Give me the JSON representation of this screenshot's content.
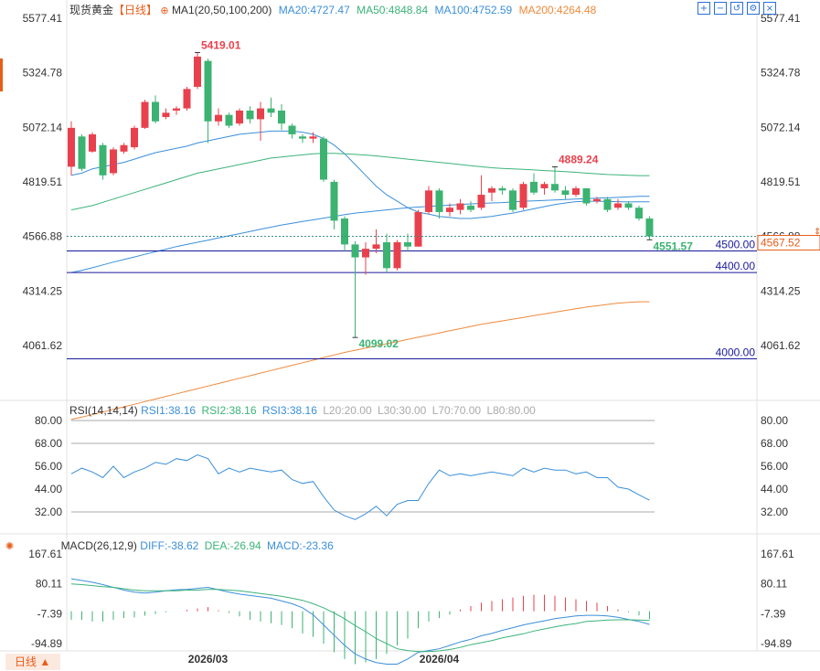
{
  "header": {
    "instrument": "现货黄金",
    "period": "【日线】",
    "ma_label": "MA1(20,50,100,200)",
    "ma20": "MA20:4727.47",
    "ma50": "MA50:4848.84",
    "ma100": "MA100:4752.59",
    "ma200": "MA200:4264.48"
  },
  "rsi_header": {
    "label": "RSI(14,14,14)",
    "rsi1": "RSI1:38.16",
    "rsi2": "RSI2:38.16",
    "rsi3": "RSI3:38.16",
    "l20": "L20:20.00",
    "l30": "L30:30.00",
    "l70": "L70:70.00",
    "l80": "L80:80.00"
  },
  "macd_header": {
    "label": "MACD(26,12,9)",
    "diff": "DIFF:-38.62",
    "dea": "DEA:-26.94",
    "macd": "MACD:-23.36"
  },
  "footer": {
    "period_button": "日线 ▲"
  },
  "colors": {
    "up": "#e8414d",
    "down": "#3cb371",
    "ma20": "#3b8fd9",
    "ma50": "#3cb37a",
    "ma100": "#3b8fd9",
    "ma200": "#f08a3c",
    "level": "#1a1a9c",
    "grid": "#e6e6e6",
    "accent": "#e85d1a"
  },
  "icons": [
    "add-circle-icon",
    "zoom-in-icon",
    "zoom-out-icon",
    "reset-icon",
    "settings-icon",
    "close-icon",
    "macd-settings-icon"
  ],
  "chart_data": [
    {
      "type": "candlestick",
      "title": "现货黄金",
      "y_ticks": [
        "5577.41",
        "5324.78",
        "5072.14",
        "4819.51",
        "4566.88",
        "4314.25",
        "4061.62"
      ],
      "ylim": [
        4061.62,
        5577.41
      ],
      "x_ticks": [
        {
          "index": 13,
          "label": "2026/03"
        },
        {
          "index": 35,
          "label": "2026/04"
        }
      ],
      "candles": [
        {
          "o": 4890,
          "h": 5100,
          "l": 4850,
          "c": 5070
        },
        {
          "o": 5030,
          "h": 5040,
          "l": 4870,
          "c": 4880
        },
        {
          "o": 4960,
          "h": 5050,
          "l": 4955,
          "c": 5040
        },
        {
          "o": 4990,
          "h": 5000,
          "l": 4830,
          "c": 4850
        },
        {
          "o": 4860,
          "h": 4980,
          "l": 4850,
          "c": 4970
        },
        {
          "o": 4960,
          "h": 5000,
          "l": 4950,
          "c": 4990
        },
        {
          "o": 4980,
          "h": 5080,
          "l": 4970,
          "c": 5070
        },
        {
          "o": 5070,
          "h": 5200,
          "l": 5065,
          "c": 5190
        },
        {
          "o": 5190,
          "h": 5220,
          "l": 5090,
          "c": 5100
        },
        {
          "o": 5120,
          "h": 5160,
          "l": 5110,
          "c": 5140
        },
        {
          "o": 5150,
          "h": 5170,
          "l": 5130,
          "c": 5160
        },
        {
          "o": 5160,
          "h": 5260,
          "l": 5150,
          "c": 5250
        },
        {
          "o": 5260,
          "h": 5419.01,
          "l": 5250,
          "c": 5400
        },
        {
          "o": 5380,
          "h": 5390,
          "l": 5000,
          "c": 5100
        },
        {
          "o": 5100,
          "h": 5160,
          "l": 5080,
          "c": 5130
        },
        {
          "o": 5130,
          "h": 5140,
          "l": 5070,
          "c": 5080
        },
        {
          "o": 5090,
          "h": 5160,
          "l": 5080,
          "c": 5150
        },
        {
          "o": 5150,
          "h": 5170,
          "l": 5090,
          "c": 5110
        },
        {
          "o": 5110,
          "h": 5190,
          "l": 5010,
          "c": 5160
        },
        {
          "o": 5160,
          "h": 5210,
          "l": 5120,
          "c": 5140
        },
        {
          "o": 5150,
          "h": 5180,
          "l": 5060,
          "c": 5090
        },
        {
          "o": 5080,
          "h": 5090,
          "l": 5020,
          "c": 5040
        },
        {
          "o": 5030,
          "h": 5040,
          "l": 5000,
          "c": 5020
        },
        {
          "o": 5020,
          "h": 5050,
          "l": 5000,
          "c": 5030
        },
        {
          "o": 5020,
          "h": 5030,
          "l": 4820,
          "c": 4830
        },
        {
          "o": 4820,
          "h": 4830,
          "l": 4600,
          "c": 4640
        },
        {
          "o": 4650,
          "h": 4660,
          "l": 4500,
          "c": 4530
        },
        {
          "o": 4530,
          "h": 4545,
          "l": 4099.02,
          "c": 4470
        },
        {
          "o": 4470,
          "h": 4540,
          "l": 4390,
          "c": 4510
        },
        {
          "o": 4510,
          "h": 4600,
          "l": 4490,
          "c": 4530
        },
        {
          "o": 4540,
          "h": 4580,
          "l": 4400,
          "c": 4420
        },
        {
          "o": 4420,
          "h": 4550,
          "l": 4410,
          "c": 4540
        },
        {
          "o": 4540,
          "h": 4580,
          "l": 4500,
          "c": 4520
        },
        {
          "o": 4520,
          "h": 4690,
          "l": 4520,
          "c": 4680
        },
        {
          "o": 4680,
          "h": 4800,
          "l": 4670,
          "c": 4780
        },
        {
          "o": 4780,
          "h": 4790,
          "l": 4650,
          "c": 4680
        },
        {
          "o": 4680,
          "h": 4720,
          "l": 4660,
          "c": 4700
        },
        {
          "o": 4690,
          "h": 4740,
          "l": 4670,
          "c": 4720
        },
        {
          "o": 4710,
          "h": 4730,
          "l": 4680,
          "c": 4690
        },
        {
          "o": 4700,
          "h": 4850,
          "l": 4690,
          "c": 4760
        },
        {
          "o": 4770,
          "h": 4800,
          "l": 4730,
          "c": 4790
        },
        {
          "o": 4790,
          "h": 4800,
          "l": 4760,
          "c": 4780
        },
        {
          "o": 4780,
          "h": 4790,
          "l": 4680,
          "c": 4690
        },
        {
          "o": 4700,
          "h": 4820,
          "l": 4690,
          "c": 4810
        },
        {
          "o": 4820,
          "h": 4860,
          "l": 4760,
          "c": 4770
        },
        {
          "o": 4790,
          "h": 4820,
          "l": 4760,
          "c": 4810
        },
        {
          "o": 4810,
          "h": 4889.24,
          "l": 4770,
          "c": 4780
        },
        {
          "o": 4780,
          "h": 4800,
          "l": 4740,
          "c": 4760
        },
        {
          "o": 4760,
          "h": 4800,
          "l": 4750,
          "c": 4790
        },
        {
          "o": 4790,
          "h": 4790,
          "l": 4710,
          "c": 4720
        },
        {
          "o": 4730,
          "h": 4750,
          "l": 4720,
          "c": 4740
        },
        {
          "o": 4740,
          "h": 4750,
          "l": 4680,
          "c": 4690
        },
        {
          "o": 4700,
          "h": 4740,
          "l": 4690,
          "c": 4720
        },
        {
          "o": 4720,
          "h": 4730,
          "l": 4690,
          "c": 4700
        },
        {
          "o": 4700,
          "h": 4710,
          "l": 4640,
          "c": 4650
        },
        {
          "o": 4650,
          "h": 4660,
          "l": 4551.57,
          "c": 4567.52
        }
      ],
      "annotations": [
        {
          "label": "5419.01",
          "index": 12,
          "value": 5419.01,
          "kind": "high"
        },
        {
          "label": "4889.24",
          "index": 46,
          "value": 4889.24,
          "kind": "high"
        },
        {
          "label": "4099.02",
          "index": 27,
          "value": 4099.02,
          "kind": "low"
        },
        {
          "label": "4551.57",
          "index": 55,
          "value": 4551.57,
          "kind": "low"
        }
      ],
      "current_price": "4567.52",
      "current_price_value": 4567.52,
      "levels": [
        {
          "label": "4500.00",
          "value": 4500
        },
        {
          "label": "4400.00",
          "value": 4400
        },
        {
          "label": "4000.00",
          "value": 4000
        }
      ],
      "ma_series": [
        {
          "name": "MA20",
          "values": [
            4850,
            4860,
            4880,
            4890,
            4900,
            4910,
            4925,
            4940,
            4955,
            4965,
            4975,
            4985,
            5000,
            5010,
            5020,
            5030,
            5040,
            5045,
            5050,
            5055,
            5055,
            5055,
            5050,
            5040,
            5020,
            4990,
            4950,
            4900,
            4850,
            4800,
            4760,
            4730,
            4700,
            4680,
            4670,
            4660,
            4655,
            4650,
            4650,
            4655,
            4660,
            4668,
            4675,
            4685,
            4695,
            4705,
            4715,
            4722,
            4728,
            4730,
            4730,
            4729,
            4728,
            4727,
            4727.47,
            4727.47
          ]
        },
        {
          "name": "MA50",
          "values": [
            4690,
            4700,
            4710,
            4725,
            4740,
            4755,
            4770,
            4785,
            4800,
            4815,
            4830,
            4845,
            4860,
            4870,
            4880,
            4890,
            4900,
            4910,
            4920,
            4930,
            4935,
            4940,
            4945,
            4950,
            4952,
            4952,
            4950,
            4947,
            4944,
            4940,
            4935,
            4930,
            4925,
            4920,
            4915,
            4910,
            4905,
            4900,
            4895,
            4890,
            4885,
            4882,
            4880,
            4878,
            4875,
            4872,
            4870,
            4867,
            4864,
            4860,
            4857,
            4854,
            4852,
            4850,
            4848.84,
            4848.84
          ]
        },
        {
          "name": "MA100",
          "values": [
            4400,
            4410,
            4422,
            4435,
            4448,
            4460,
            4472,
            4484,
            4496,
            4508,
            4520,
            4530,
            4540,
            4550,
            4560,
            4570,
            4580,
            4590,
            4600,
            4610,
            4620,
            4628,
            4636,
            4644,
            4652,
            4660,
            4668,
            4675,
            4680,
            4685,
            4690,
            4695,
            4700,
            4703,
            4706,
            4709,
            4712,
            4715,
            4718,
            4720,
            4722,
            4724,
            4727,
            4730,
            4732,
            4734,
            4736,
            4738,
            4740,
            4742,
            4744,
            4746,
            4748,
            4750,
            4752.59,
            4752.59
          ]
        },
        {
          "name": "MA200",
          "values": [
            3720,
            3730,
            3742,
            3754,
            3766,
            3778,
            3790,
            3802,
            3814,
            3826,
            3838,
            3850,
            3862,
            3874,
            3886,
            3898,
            3910,
            3922,
            3934,
            3946,
            3958,
            3970,
            3982,
            3994,
            4006,
            4018,
            4030,
            4040,
            4050,
            4060,
            4070,
            4080,
            4090,
            4100,
            4110,
            4120,
            4130,
            4140,
            4150,
            4160,
            4168,
            4176,
            4184,
            4192,
            4200,
            4208,
            4216,
            4224,
            4232,
            4240,
            4246,
            4252,
            4258,
            4262,
            4264.48,
            4264.48
          ]
        }
      ]
    },
    {
      "type": "line",
      "title": "RSI(14,14,14)",
      "y_ticks": [
        "80.00",
        "68.00",
        "56.00",
        "44.00",
        "32.00"
      ],
      "ylim": [
        20,
        80
      ],
      "guides": [
        80,
        68,
        32
      ],
      "series": [
        {
          "name": "RSI1",
          "values": [
            52,
            55,
            53,
            50,
            56,
            50,
            53,
            55,
            58,
            57,
            60,
            59,
            62,
            60,
            52,
            55,
            53,
            55,
            54,
            53,
            54,
            49,
            47,
            48,
            40,
            33,
            30,
            28,
            31,
            35,
            30,
            36,
            38,
            38,
            47,
            54,
            51,
            52,
            51,
            52,
            53,
            52,
            51,
            55,
            53,
            55,
            54,
            54,
            52,
            53,
            50,
            50,
            45,
            44,
            41,
            38.16
          ]
        },
        {
          "name": "RSI2",
          "values": [
            52,
            55,
            53,
            50,
            56,
            50,
            53,
            55,
            58,
            57,
            60,
            59,
            62,
            60,
            52,
            55,
            53,
            55,
            54,
            53,
            54,
            49,
            47,
            48,
            40,
            33,
            30,
            28,
            31,
            35,
            30,
            36,
            38,
            38,
            47,
            54,
            51,
            52,
            51,
            52,
            53,
            52,
            51,
            55,
            53,
            55,
            54,
            54,
            52,
            53,
            50,
            50,
            45,
            44,
            41,
            38.16
          ]
        },
        {
          "name": "RSI3",
          "values": [
            52,
            55,
            53,
            50,
            56,
            50,
            53,
            55,
            58,
            57,
            60,
            59,
            62,
            60,
            52,
            55,
            53,
            55,
            54,
            53,
            54,
            49,
            47,
            48,
            40,
            33,
            30,
            28,
            31,
            35,
            30,
            36,
            38,
            38,
            47,
            54,
            51,
            52,
            51,
            52,
            53,
            52,
            51,
            55,
            53,
            55,
            54,
            54,
            52,
            53,
            50,
            50,
            45,
            44,
            41,
            38.16
          ]
        }
      ]
    },
    {
      "type": "bar",
      "title": "MACD(26,12,9)",
      "y_ticks": [
        "167.61",
        "80.11",
        "-7.39",
        "-94.89"
      ],
      "ylim": [
        -175,
        167.61
      ],
      "series": [
        {
          "name": "DIFF",
          "values": [
            95,
            90,
            85,
            78,
            70,
            62,
            56,
            53,
            56,
            60,
            63,
            64,
            67,
            70,
            63,
            56,
            50,
            46,
            42,
            38,
            30,
            22,
            10,
            -10,
            -40,
            -70,
            -100,
            -125,
            -140,
            -150,
            -155,
            -155,
            -140,
            -120,
            -115,
            -110,
            -100,
            -90,
            -82,
            -72,
            -65,
            -56,
            -48,
            -40,
            -34,
            -28,
            -22,
            -18,
            -14,
            -12,
            -12,
            -14,
            -18,
            -24,
            -30,
            -38.62
          ]
        },
        {
          "name": "DEA",
          "values": [
            80,
            78,
            75,
            72,
            70,
            66,
            62,
            60,
            60,
            60,
            60,
            62,
            62,
            64,
            64,
            62,
            60,
            56,
            52,
            48,
            44,
            38,
            32,
            22,
            10,
            -5,
            -22,
            -42,
            -60,
            -80,
            -95,
            -110,
            -115,
            -118,
            -118,
            -116,
            -112,
            -106,
            -98,
            -92,
            -86,
            -78,
            -72,
            -66,
            -58,
            -52,
            -46,
            -40,
            -36,
            -30,
            -28,
            -26,
            -25,
            -25,
            -26,
            -26.94
          ]
        },
        {
          "name": "MACD",
          "values": [
            -25,
            -25,
            -30,
            -30,
            -25,
            -20,
            -18,
            -13,
            -8,
            -3,
            0,
            4,
            8,
            12,
            3,
            -5,
            -15,
            -25,
            -30,
            -35,
            -40,
            -50,
            -65,
            -75,
            -95,
            -120,
            -140,
            -155,
            -150,
            -140,
            -125,
            -100,
            -80,
            -50,
            -30,
            -20,
            -10,
            5,
            15,
            25,
            30,
            35,
            40,
            45,
            48,
            48,
            45,
            40,
            35,
            30,
            25,
            15,
            5,
            -3,
            -12,
            -23.36
          ]
        }
      ]
    }
  ]
}
